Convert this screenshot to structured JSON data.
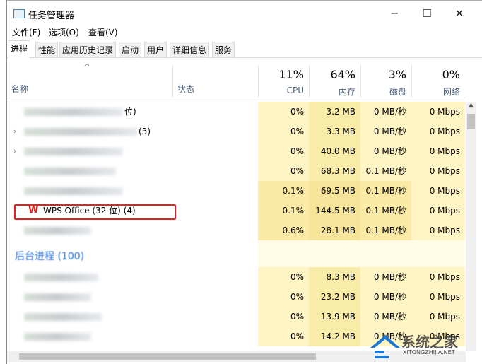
{
  "window": {
    "title": "任务管理器",
    "controls": {
      "minimize": "─",
      "maximize": "☐",
      "close": "✕"
    }
  },
  "menu": [
    "文件(F)",
    "选项(O)",
    "查看(V)"
  ],
  "tabs": [
    {
      "label": "进程",
      "active": true
    },
    {
      "label": "性能"
    },
    {
      "label": "应用历史记录"
    },
    {
      "label": "启动"
    },
    {
      "label": "用户"
    },
    {
      "label": "详细信息"
    },
    {
      "label": "服务"
    }
  ],
  "header": {
    "sort_arrow": "^",
    "name": "名称",
    "status": "状态",
    "cpu": {
      "pct": "11%",
      "label": "CPU"
    },
    "mem": {
      "pct": "64%",
      "label": "内存"
    },
    "disk": {
      "pct": "3%",
      "label": "磁盘"
    },
    "net": {
      "pct": "0%",
      "label": "网络"
    }
  },
  "rows": [
    {
      "name": "位)",
      "cpu": "0%",
      "mem": "3.2 MB",
      "disk": "0 MB/秒",
      "net": "0 Mbps"
    },
    {
      "name": "(3)",
      "cpu": "0%",
      "mem": "3.3 MB",
      "disk": "0 MB/秒",
      "net": "0 Mbps"
    },
    {
      "name": "",
      "cpu": "0%",
      "mem": "40.0 MB",
      "disk": "0 MB/秒",
      "net": "0 Mbps"
    },
    {
      "name": "",
      "cpu": "0%",
      "mem": "68.3 MB",
      "disk": "0.1 MB/秒",
      "net": "0 Mbps"
    },
    {
      "name": "",
      "cpu": "0.1%",
      "mem": "69.5 MB",
      "disk": "0.1 MB/秒",
      "net": "0 Mbps"
    },
    {
      "name": "WPS Office (32 位) (4)",
      "cpu": "0.1%",
      "mem": "144.5 MB",
      "disk": "0.1 MB/秒",
      "net": "0 Mbps"
    },
    {
      "name": "",
      "cpu": "0.6%",
      "mem": "28.1 MB",
      "disk": "0.1 MB/秒",
      "net": "0 Mbps"
    }
  ],
  "group": "后台进程 (100)",
  "bg_rows": [
    {
      "cpu": "0%",
      "mem": "8.3 MB",
      "disk": "0 MB/秒",
      "net": "0 Mbps"
    },
    {
      "cpu": "0%",
      "mem": "23.2 MB",
      "disk": "0 MB/秒",
      "net": "0 Mbps"
    },
    {
      "cpu": "0%",
      "mem": "13.9 MB",
      "disk": "0 MB/秒",
      "net": "0 Mbps"
    },
    {
      "cpu": "0%",
      "mem": "14.2 MB",
      "disk": "0 MB/秒",
      "net": "0 Mbps"
    }
  ],
  "watermark": {
    "text": "系统之家",
    "url_text": "XITONGZHIJIA.NET"
  },
  "colors": {
    "highlight": "#e8201c",
    "cell_bg": "#fff4c4",
    "mem_bg": "#f9eca8",
    "group": "#1f6bd1"
  }
}
